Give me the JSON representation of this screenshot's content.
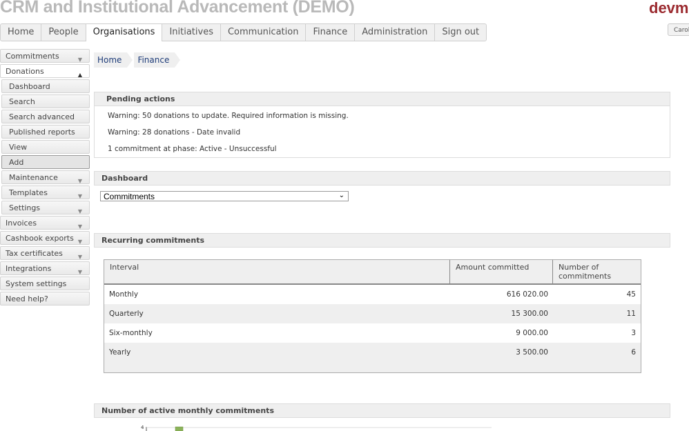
{
  "app": {
    "title": "CRM and Institutional Advancement (DEMO)",
    "brand": "devm",
    "user": "Carol"
  },
  "topnav": [
    "Home",
    "People",
    "Organisations",
    "Initiatives",
    "Communication",
    "Finance",
    "Administration",
    "Sign out"
  ],
  "topnav_active": "Organisations",
  "sidebar": [
    {
      "label": "Commitments",
      "caret": "down"
    },
    {
      "label": "Donations",
      "caret": "up",
      "active": true
    },
    {
      "label": "Dashboard",
      "sub": true
    },
    {
      "label": "Search",
      "sub": true
    },
    {
      "label": "Search advanced",
      "sub": true
    },
    {
      "label": "Published reports",
      "sub": true
    },
    {
      "label": "View",
      "sub": true
    },
    {
      "label": "Add",
      "sub": true,
      "selected": true
    },
    {
      "label": "Maintenance",
      "sub": true,
      "caret": "down"
    },
    {
      "label": "Templates",
      "sub": true,
      "caret": "down"
    },
    {
      "label": "Settings",
      "sub": true,
      "caret": "down"
    },
    {
      "label": "Invoices",
      "caret": "down"
    },
    {
      "label": "Cashbook exports",
      "caret": "down"
    },
    {
      "label": "Tax certificates",
      "caret": "down"
    },
    {
      "label": "Integrations",
      "caret": "down"
    },
    {
      "label": "System settings"
    },
    {
      "label": "Need help?"
    }
  ],
  "breadcrumb": [
    "Home",
    "Finance"
  ],
  "pending": {
    "title": "Pending actions",
    "items": [
      "Warning: 50 donations to update. Required information is missing.",
      "Warning: 28 donations - Date invalid",
      "1 commitment at phase: Active - Unsuccessful"
    ]
  },
  "dashboard": {
    "title": "Dashboard",
    "selected": "Commitments"
  },
  "recurring": {
    "title": "Recurring commitments",
    "headers": [
      "Interval",
      "Amount committed",
      "Number of commitments"
    ],
    "rows": [
      [
        "Monthly",
        "616 020.00",
        "45"
      ],
      [
        "Quarterly",
        "15 300.00",
        "11"
      ],
      [
        "Six-monthly",
        "9 000.00",
        "3"
      ],
      [
        "Yearly",
        "3 500.00",
        "6"
      ]
    ]
  },
  "monthly_chart": {
    "title": "Number of active monthly commitments",
    "y_tick": "4",
    "bar_color": "#8bb35a"
  }
}
